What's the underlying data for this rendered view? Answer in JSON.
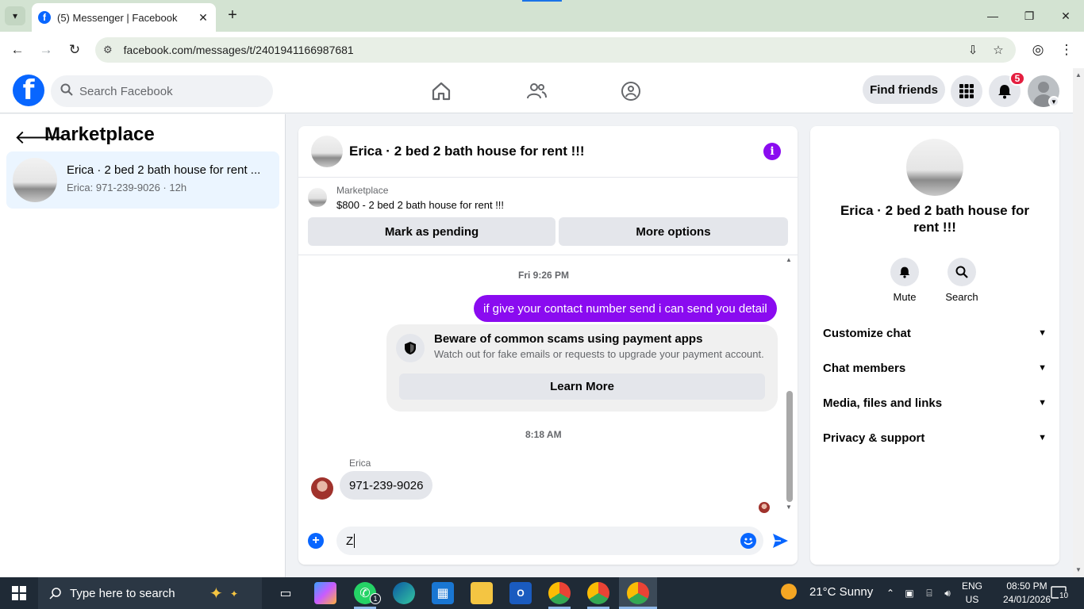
{
  "browser": {
    "tab_title": "(5) Messenger | Facebook",
    "url": "facebook.com/messages/t/2401941166987681"
  },
  "fb_header": {
    "search_placeholder": "Search Facebook",
    "find_friends_label": "Find friends",
    "notification_count": "5"
  },
  "left": {
    "title": "Marketplace",
    "conversation": {
      "name": "Erica · 2 bed 2 bath house for rent ...",
      "subtitle": "Erica: 971-239-9026 · 12h"
    }
  },
  "chat": {
    "title": "Erica · 2 bed 2 bath house for rent !!!",
    "marketplace_label": "Marketplace",
    "listing": "$800 - 2 bed 2 bath house for rent !!!",
    "mark_pending_label": "Mark as pending",
    "more_options_label": "More options",
    "timestamp_1": "Fri 9:26 PM",
    "outgoing_message": "if give your contact number send i can send you detail",
    "scam_title": "Beware of common scams using payment apps",
    "scam_body": "Watch out for fake emails or requests to upgrade your payment account.",
    "learn_more_label": "Learn More",
    "timestamp_2": "8:18 AM",
    "sender_name": "Erica",
    "incoming_message": "971-239-9026",
    "compose_value": "Z"
  },
  "right": {
    "title": "Erica · 2 bed 2 bath house for rent !!!",
    "mute_label": "Mute",
    "search_label": "Search",
    "sections": [
      "Customize chat",
      "Chat members",
      "Media, files and links",
      "Privacy & support"
    ]
  },
  "taskbar": {
    "search_placeholder": "Type here to search",
    "weather": "21°C  Sunny",
    "lang_top": "ENG",
    "lang_bottom": "US",
    "time": "08:50 PM",
    "date": "24/01/2026",
    "notifications": "10",
    "whatsapp_badge": "1"
  },
  "colors": {
    "fb_blue": "#0866ff",
    "messenger_purple": "#8a0bf0",
    "badge_red": "#e41e3f"
  }
}
